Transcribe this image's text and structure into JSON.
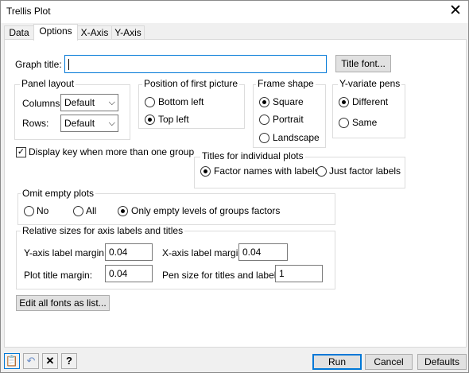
{
  "window": {
    "title": "Trellis Plot",
    "close_glyph": "✕"
  },
  "tabs": [
    {
      "label": "Data"
    },
    {
      "label": "Options"
    },
    {
      "label": "X-Axis"
    },
    {
      "label": "Y-Axis"
    }
  ],
  "graph_title": {
    "label": "Graph title:",
    "value": "",
    "font_button": "Title font..."
  },
  "panel_layout": {
    "label": "Panel layout",
    "columns_label": "Columns:",
    "columns_value": "Default",
    "rows_label": "Rows:",
    "rows_value": "Default"
  },
  "first_picture": {
    "label": "Position of first picture",
    "options": [
      "Bottom left",
      "Top left"
    ],
    "selected": "Top left"
  },
  "frame_shape": {
    "label": "Frame shape",
    "options": [
      "Square",
      "Portrait",
      "Landscape"
    ],
    "selected": "Square"
  },
  "yvariate_pens": {
    "label": "Y-variate pens",
    "options": [
      "Different",
      "Same"
    ],
    "selected": "Different"
  },
  "display_key": {
    "label": "Display key when more than one group",
    "checked": true
  },
  "titles_individual": {
    "label": "Titles for individual plots",
    "options": [
      "Factor names with labels",
      "Just factor labels"
    ],
    "selected": "Factor names with labels"
  },
  "omit_empty": {
    "label": "Omit empty plots",
    "options": [
      "No",
      "All",
      "Only empty levels of groups factors"
    ],
    "selected": "Only empty levels of groups factors"
  },
  "relative_sizes": {
    "label": "Relative sizes for axis labels and titles",
    "yaxis_label": "Y-axis label margin:",
    "yaxis_value": "0.04",
    "xaxis_label": "X-axis label margin:",
    "xaxis_value": "0.04",
    "plot_title_label": "Plot title margin:",
    "plot_title_value": "0.04",
    "pen_size_label": "Pen size for titles and labels:",
    "pen_size_value": "1"
  },
  "edit_fonts_button": "Edit all fonts as list...",
  "footer": {
    "run": "Run",
    "cancel": "Cancel",
    "defaults": "Defaults"
  }
}
